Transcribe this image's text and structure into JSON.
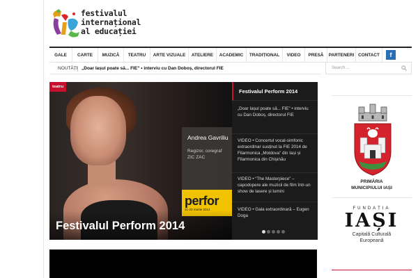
{
  "logo": {
    "lines": [
      "festivalul",
      "internațional",
      "al educației"
    ],
    "mark": "FIE"
  },
  "nav": {
    "items": [
      "GALE",
      "CARTE",
      "MUZICĂ",
      "TEATRU",
      "ARTE VIZUALE",
      "ATELIERE",
      "ACADEMIC",
      "TRADIȚIONAL",
      "VIDEO",
      "PRESĂ",
      "PARTENERI",
      "CONTACT"
    ],
    "facebook_glyph": "f"
  },
  "ticker": {
    "label": "NOUTĂȚI",
    "text": "„Doar Iașul poate să... FIE” • interviu cu Dan Doboș, directorul FIE"
  },
  "search": {
    "placeholder": "Search ..."
  },
  "hero": {
    "tag": "teatru",
    "title": "Festivalul Perform 2014",
    "card_name": "Andrea Gavriliu",
    "card_role_1": "Regizor, coregraf",
    "card_role_2": "ZIC ZAC",
    "poster_text": "perfor",
    "poster_sub": "21-23 martie 2014"
  },
  "slides": [
    "Festivalul Perform 2014",
    "„Doar Iașul poate să... FIE” • interviu cu Dan Doboș, directorul FIE",
    "VIDEO • Concertul vocal-simfonic extraordinar susținut la FIE 2014 de Filarmonica „Moldova” din Iași și Filarmonica din Chișinău",
    "VIDEO • “The Masterpiece” – capodopere ale muzicii de film într-un show de lasere și lumini",
    "VIDEO • Gala extraordinară – Eugen Doga"
  ],
  "slider": {
    "active_index": 0,
    "total": 5
  },
  "sidebar": {
    "crest_label_1": "PRIMĂRIA",
    "crest_label_2": "MUNICIPIULUI IAȘI",
    "fund_top": "FUNDAȚIA",
    "fund_big": "IAȘI",
    "fund_cap_1": "Capitală Culturală",
    "fund_cap_2": "Europeană"
  },
  "colors": {
    "accent": "#c8102e",
    "facebook": "#2a6fb6",
    "dark": "#1b1b1b"
  }
}
